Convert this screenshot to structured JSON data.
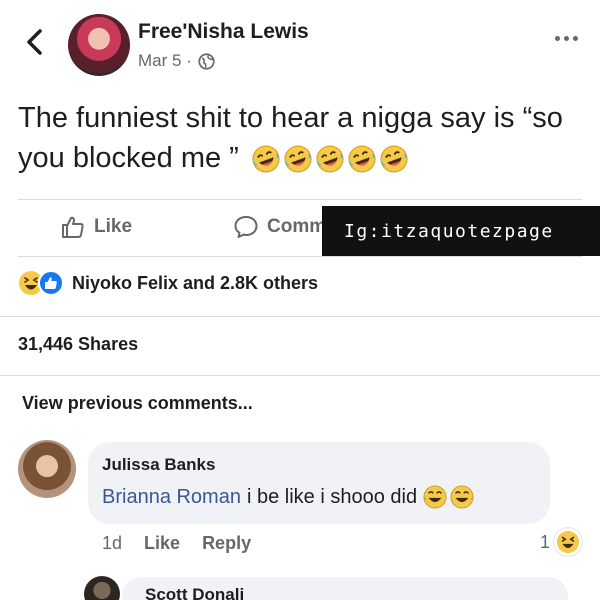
{
  "post": {
    "author": "Free'Nisha Lewis",
    "date": "Mar 5 ·",
    "text": "The funniest shit to hear a nigga say is “so you blocked me ”",
    "emoji_count": 5
  },
  "actions": {
    "like_label": "Like",
    "comment_label": "Comm"
  },
  "watermark": "Ig:itzaquotezpage",
  "reactions": {
    "label": "Niyoko Felix and 2.8K others"
  },
  "shares": "31,446 Shares",
  "view_previous": "View previous comments...",
  "comment": {
    "author": "Julissa Banks",
    "mention": "Brianna Roman",
    "text": "i be like i shooo did",
    "time": "1d",
    "like_label": "Like",
    "reply_label": "Reply",
    "reaction_count": "1"
  },
  "next_comment": {
    "author": "Scott Donali"
  },
  "icons": {
    "back": "back-chevron-icon",
    "more": "more-dots-icon",
    "globe": "globe-icon",
    "like": "thumbs-up-icon",
    "comment": "comment-bubble-icon",
    "laugh": "rofl-emoji-icon",
    "haha": "haha-emoji-icon"
  },
  "colors": {
    "text": "#1c1e21",
    "secondary": "#65676b",
    "link": "#385898",
    "bubble": "#f0f2f5",
    "divider": "#dadde1",
    "watermark_bg": "#111111"
  }
}
